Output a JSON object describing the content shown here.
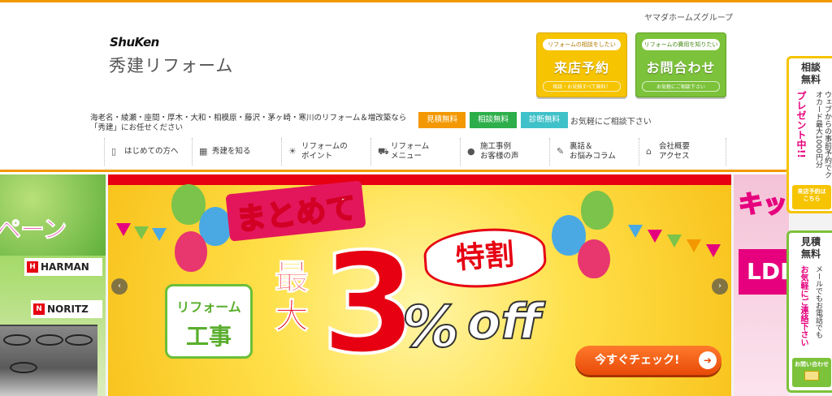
{
  "header": {
    "group_name": "ヤマダホームズグループ",
    "logo_latin": "ShuKen",
    "logo_jp": "秀建リフォーム",
    "tagline": "海老名・綾瀬・座間・厚木・大和・相模原・藤沢・茅ヶ崎・寒川のリフォーム＆増改築なら「秀建」にお任せください",
    "cta_visit": {
      "small": "リフォームの相談をしたい",
      "big": "来店予約",
      "note": "相談・お見積すべて無料！"
    },
    "cta_inquiry": {
      "small": "リフォームの費用を知りたい",
      "big": "お問合わせ",
      "note": "お気軽にご相談下さい"
    },
    "badges": [
      "見積無料",
      "相談無料",
      "診断無料"
    ],
    "badge_note": "お気軽にご相談下さい"
  },
  "nav": {
    "items": [
      {
        "label": "はじめての方へ",
        "icon": "book-icon"
      },
      {
        "label": "秀建を知る",
        "icon": "building-icon"
      },
      {
        "label": "リフォームの\nポイント",
        "icon": "lightbulb-icon"
      },
      {
        "label": "リフォーム\nメニュー",
        "icon": "cart-icon"
      },
      {
        "label": "施工事例\nお客様の声",
        "icon": "person-icon"
      },
      {
        "label": "裏話＆\nお悩みコラム",
        "icon": "pencil-icon"
      },
      {
        "label": "会社概要\nアクセス",
        "icon": "company-icon"
      }
    ]
  },
  "slider": {
    "left": {
      "campaign": "ペーン",
      "brand1": "HARMAN",
      "brand2": "NORITZ"
    },
    "main": {
      "title": "まとめて",
      "tokuwari": "特割",
      "reform_l1": "リフォーム",
      "reform_l2": "工事",
      "saidai": "最大",
      "big_num": "3",
      "percent": "%",
      "off": "off",
      "check_label": "今すぐチェック!"
    },
    "right": {
      "kit": "キッ",
      "ldk": "LDK"
    },
    "prev": "‹",
    "next": "›"
  },
  "float_panel": {
    "consult": {
      "head": "相談\n無料",
      "text": "ウェブからの事前予約でクオカード最大1000円分",
      "present": "プレゼント中!!",
      "button": "来店予約は\nこちら"
    },
    "estimate": {
      "head": "見積\n無料",
      "text": "メールでもお電話でも",
      "cta": "お気軽にご連絡下さい",
      "button": "お問い合わせ"
    }
  },
  "colors": {
    "orange": "#f39800",
    "green": "#7cc23a",
    "yellow": "#f6c400",
    "red": "#e60012",
    "teal": "#3fc1c9"
  }
}
